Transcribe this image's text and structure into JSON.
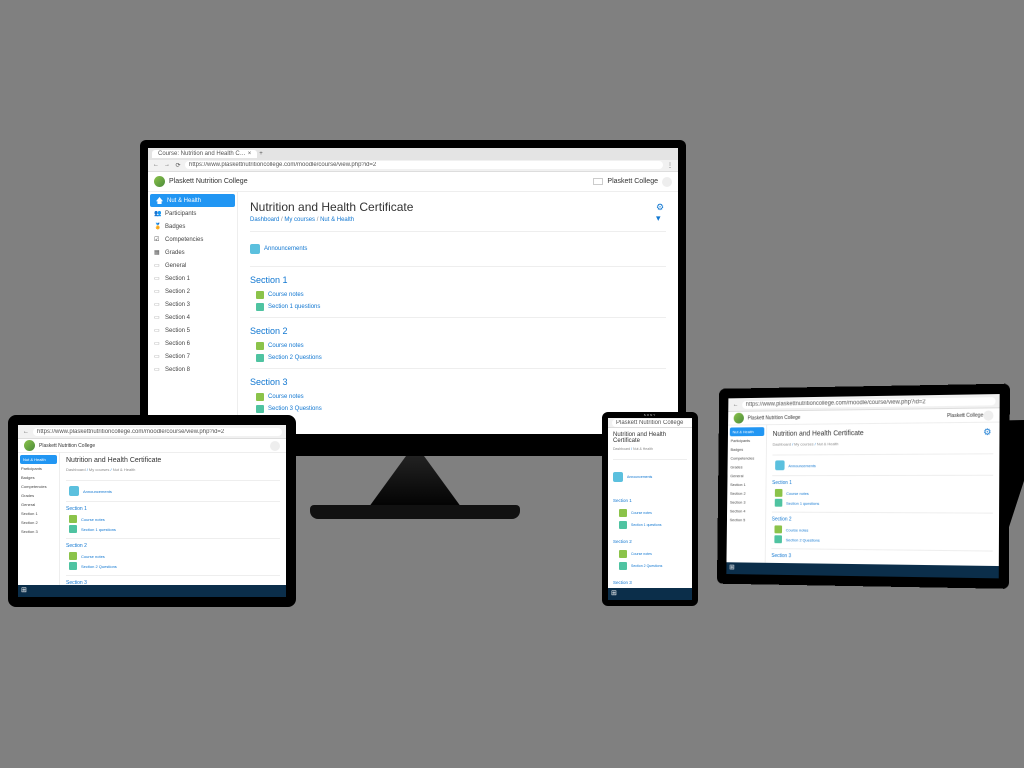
{
  "browser": {
    "tab_title": "Course: Nutrition and Health C…",
    "url": "https://www.plaskettnutritioncollege.com/moodle/course/view.php?id=2"
  },
  "header": {
    "site_name": "Plaskett Nutrition College",
    "user_name": "Plaskett College"
  },
  "sidebar": {
    "active": "Nut & Health",
    "items": [
      {
        "label": "Nut & Health"
      },
      {
        "label": "Participants"
      },
      {
        "label": "Badges"
      },
      {
        "label": "Competencies"
      },
      {
        "label": "Grades"
      },
      {
        "label": "General"
      },
      {
        "label": "Section 1"
      },
      {
        "label": "Section 2"
      },
      {
        "label": "Section 3"
      },
      {
        "label": "Section 4"
      },
      {
        "label": "Section 5"
      },
      {
        "label": "Section 6"
      },
      {
        "label": "Section 7"
      },
      {
        "label": "Section 8"
      }
    ]
  },
  "page": {
    "title": "Nutrition and Health Certificate",
    "breadcrumb": [
      "Dashboard",
      "My courses",
      "Nut & Health"
    ],
    "announcements_label": "Announcements",
    "sections": [
      {
        "title": "Section 1",
        "activities": [
          {
            "type": "book",
            "label": "Course notes"
          },
          {
            "type": "quiz",
            "label": "Section 1 questions"
          }
        ]
      },
      {
        "title": "Section 2",
        "activities": [
          {
            "type": "book",
            "label": "Course notes"
          },
          {
            "type": "quiz",
            "label": "Section 2 Questions"
          }
        ]
      },
      {
        "title": "Section 3",
        "activities": [
          {
            "type": "book",
            "label": "Course notes"
          },
          {
            "type": "quiz",
            "label": "Section 3 Questions"
          }
        ]
      }
    ]
  }
}
